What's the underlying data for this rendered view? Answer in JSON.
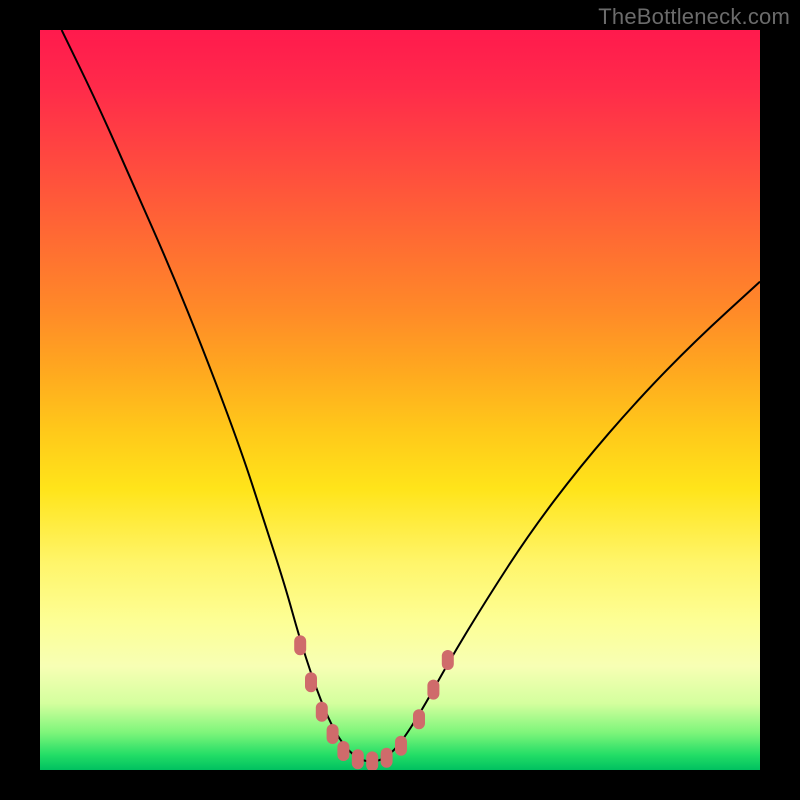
{
  "watermark": "TheBottleneck.com",
  "chart_data": {
    "type": "line",
    "title": "",
    "xlabel": "",
    "ylabel": "",
    "xlim": [
      0,
      100
    ],
    "ylim": [
      0,
      100
    ],
    "series": [
      {
        "name": "curve",
        "x": [
          3,
          8,
          13,
          18,
          23,
          28,
          31,
          34,
          36,
          38,
          40,
          42,
          44,
          46,
          48,
          50,
          53,
          57,
          62,
          68,
          75,
          83,
          91,
          100
        ],
        "y": [
          100,
          90,
          79,
          68,
          56,
          43,
          34,
          25,
          18,
          12,
          7,
          3.5,
          1.6,
          1.0,
          1.6,
          3.5,
          8,
          15,
          23,
          32,
          41,
          50,
          58,
          66
        ]
      }
    ],
    "markers": [
      {
        "name": "left-dash-1",
        "x": 36.0,
        "y": 17.0
      },
      {
        "name": "left-dash-2",
        "x": 37.5,
        "y": 12.0
      },
      {
        "name": "left-dash-3",
        "x": 39.0,
        "y": 8.0
      },
      {
        "name": "left-dash-4",
        "x": 40.5,
        "y": 5.0
      },
      {
        "name": "bottom-1",
        "x": 42.0,
        "y": 2.7
      },
      {
        "name": "bottom-2",
        "x": 44.0,
        "y": 1.6
      },
      {
        "name": "bottom-3",
        "x": 46.0,
        "y": 1.3
      },
      {
        "name": "bottom-4",
        "x": 48.0,
        "y": 1.8
      },
      {
        "name": "bottom-5",
        "x": 50.0,
        "y": 3.4
      },
      {
        "name": "right-dash-1",
        "x": 52.5,
        "y": 7.0
      },
      {
        "name": "right-dash-2",
        "x": 54.5,
        "y": 11.0
      },
      {
        "name": "right-dash-3",
        "x": 56.5,
        "y": 15.0
      }
    ],
    "marker_color": "#cf6b6b"
  }
}
